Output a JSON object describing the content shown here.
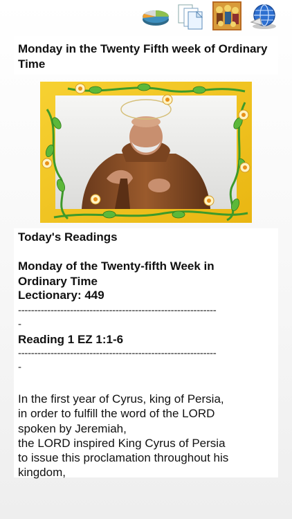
{
  "toolbar": {
    "icons": [
      "pie-chart-icon",
      "documents-icon",
      "saints-icon",
      "globe-icon"
    ]
  },
  "title": "Monday in the Twenty Fifth week of Ordinary Time",
  "readings": {
    "header": "Today's Readings",
    "day_line1": "Monday of the Twenty-fifth Week in",
    "day_line2": "Ordinary Time",
    "lectionary": "Lectionary: 449",
    "divider": "-------------------------------------------------------------",
    "divider_tail": "-",
    "reading_title": "Reading 1 EZ 1:1-6",
    "body_lines": [
      "In the first year of Cyrus, king of Persia,",
      "in order to fulfill the word of the LORD",
      "spoken by Jeremiah,",
      "the LORD inspired King Cyrus of Persia",
      "to issue this proclamation throughout his",
      "kingdom,"
    ]
  },
  "colors": {
    "frame_yellow": "#f2c21b",
    "vine_green": "#3d9a2a",
    "background": "#f4f4f4"
  }
}
